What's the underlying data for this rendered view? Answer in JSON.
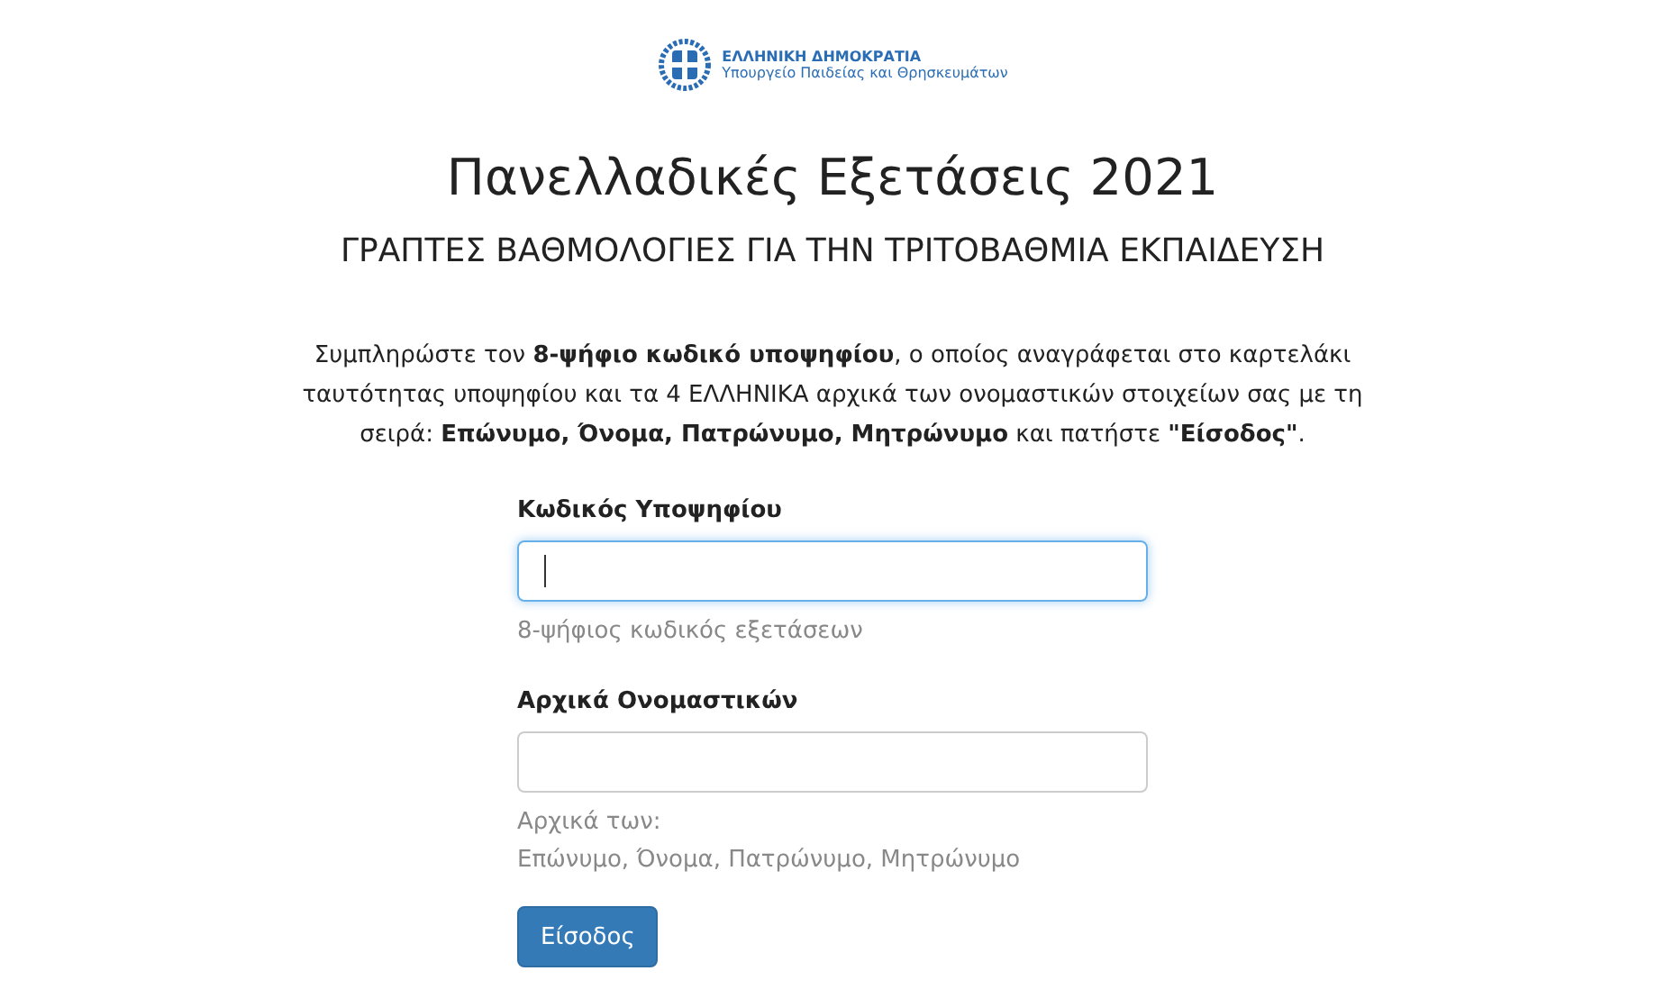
{
  "header": {
    "org": "ΕΛΛΗΝΙΚΗ ΔΗΜΟΚΡΑΤΙΑ",
    "ministry": "Υπουργείο Παιδείας και Θρησκευμάτων"
  },
  "title": "Πανελλαδικές Εξετάσεις 2021",
  "subtitle": "ΓΡΑΠΤΕΣ ΒΑΘΜΟΛΟΓΙΕΣ ΓΙΑ ΤΗΝ ΤΡΙΤΟΒΑΘΜΙΑ ΕΚΠΑΙΔΕΥΣΗ",
  "instructions": "Συμπληρώστε τον **8-ψήφιο κωδικό υποψηφίου**, ο οποίος αναγράφεται στο καρτελάκι ταυτότητας υποψηφίου και τα 4 ΕΛΛΗΝΙΚΑ αρχικά των ονομαστικών στοιχείων σας με τη σειρά: **Επώνυμο, Όνομα, Πατρώνυμο, Μητρώνυμο** και πατήστε **\"Είσοδος\"**.",
  "fields": [
    {
      "label": "Κωδικός Υποψηφίου",
      "focused": true,
      "help": [
        "8-ψήφιος κωδικός εξετάσεων"
      ]
    },
    {
      "label": "Αρχικά Ονομαστικών",
      "focused": false,
      "help": [
        "Αρχικά των:",
        "Επώνυμο, Όνομα, Πατρώνυμο, Μητρώνυμο"
      ]
    }
  ],
  "submit": "Είσοδος"
}
